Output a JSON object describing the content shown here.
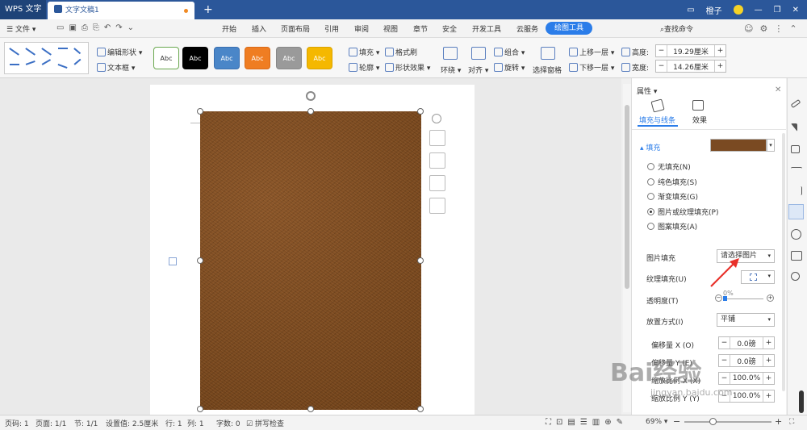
{
  "titlebar": {
    "app": "WPS 文字",
    "doc_tab": "文字文稿1",
    "add_tab": "+",
    "user": "橙子"
  },
  "menu": {
    "file": "文件",
    "tabs": [
      "开始",
      "插入",
      "页面布局",
      "引用",
      "审阅",
      "视图",
      "章节",
      "安全",
      "开发工具",
      "云服务"
    ],
    "active_tab": "绘图工具",
    "search": "查找命令"
  },
  "ribbon": {
    "edit_shape": "编辑形状",
    "textbox": "文本框",
    "styles": [
      {
        "label": "Abc",
        "bg": "#ffffff",
        "fg": "#333333",
        "border": "#6aa84f"
      },
      {
        "label": "Abc",
        "bg": "#000000",
        "fg": "#ffffff",
        "border": "#000000"
      },
      {
        "label": "Abc",
        "bg": "#4a86c8",
        "fg": "#ffffff",
        "border": "#3a6fb0"
      },
      {
        "label": "Abc",
        "bg": "#ef7d22",
        "fg": "#ffffff",
        "border": "#d86a18"
      },
      {
        "label": "Abc",
        "bg": "#9a9a9a",
        "fg": "#ffffff",
        "border": "#888888"
      },
      {
        "label": "Abc",
        "bg": "#f5b800",
        "fg": "#ffffff",
        "border": "#d9a300"
      }
    ],
    "fill": "填充",
    "outline": "轮廓",
    "format_brush": "格式刷",
    "shape_effect": "形状效果",
    "wrap": "环绕",
    "align": "对齐",
    "group": "组合",
    "rotate": "旋转",
    "selection_pane": "选择窗格",
    "bring_forward": "上移一层",
    "send_backward": "下移一层",
    "height_label": "高度:",
    "height_value": "19.29厘米",
    "width_label": "宽度:",
    "width_value": "14.26厘米"
  },
  "panel": {
    "title": "属性",
    "tab_fill_line": "填充与线条",
    "tab_effects": "效果",
    "fill_section": "填充",
    "fill_options": [
      "无填充(N)",
      "纯色填充(S)",
      "渐变填充(G)",
      "图片或纹理填充(P)",
      "图案填充(A)"
    ],
    "selected_option": 3,
    "picture_fill_label": "图片填充",
    "picture_fill_value": "请选择图片",
    "texture_fill_label": "纹理填充(U)",
    "transparency_label": "透明度(T)",
    "transparency_value": "0%",
    "placement_label": "放置方式(I)",
    "placement_value": "平铺",
    "offset_x_label": "偏移量 X (O)",
    "offset_x_value": "0.0磅",
    "offset_y_label": "偏移量 Y (E)",
    "offset_y_value": "0.0磅",
    "scale_x_label": "缩放比例 X (X)",
    "scale_x_value": "100.0%",
    "scale_y_label": "缩放比例 Y (Y)",
    "scale_y_value": "100.0%"
  },
  "statusbar": {
    "page_no": "页码: 1",
    "pages": "页面: 1/1",
    "section": "节: 1/1",
    "setting": "设置值: 2.5厘米",
    "row": "行: 1",
    "col": "列: 1",
    "words": "字数: 0",
    "spell": "拼写检查",
    "zoom": "69%"
  },
  "watermark": {
    "text": "Bai经验",
    "url": "jingyan.baidu.com"
  }
}
